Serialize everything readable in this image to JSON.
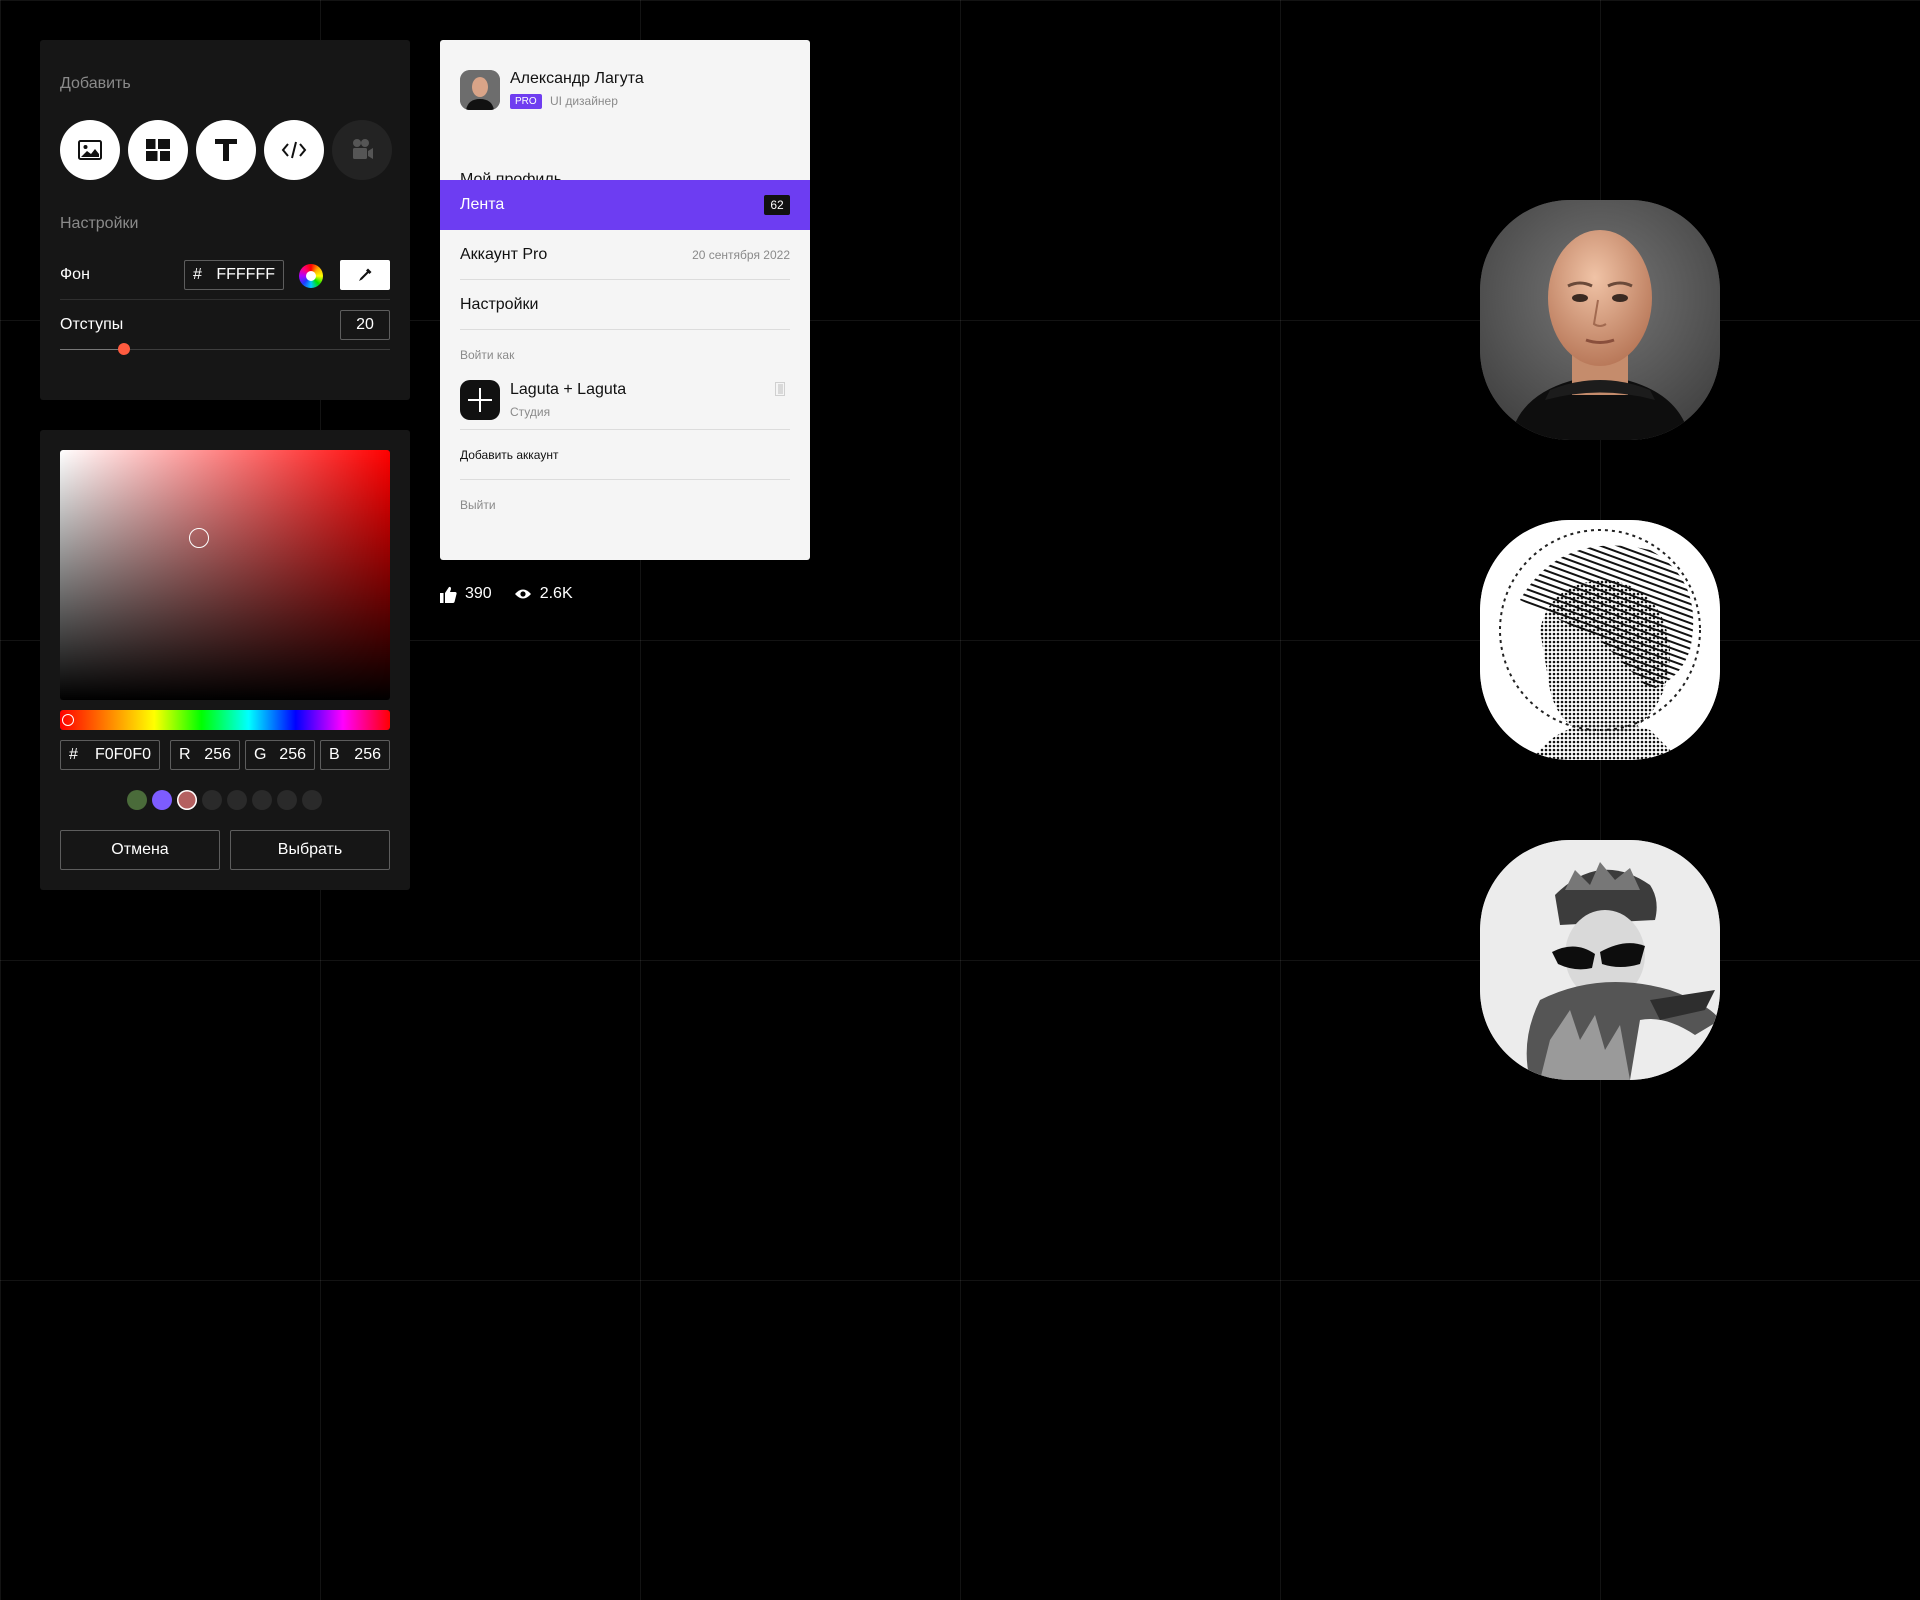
{
  "add_panel": {
    "title": "Добавить",
    "buttons": [
      {
        "icon": "image-icon"
      },
      {
        "icon": "layout-grid-icon"
      },
      {
        "icon": "text-icon"
      },
      {
        "icon": "code-icon"
      },
      {
        "icon": "video-camera-icon",
        "disabled": true
      }
    ],
    "settings_title": "Настройки",
    "background": {
      "label": "Фон",
      "hash": "#",
      "value": "FFFFFF"
    },
    "padding": {
      "label": "Отступы",
      "value": "20",
      "fraction": 0.195
    }
  },
  "color_picker": {
    "hue_fraction": 0.025,
    "saturation": 0.42,
    "brightness": 0.65,
    "hex": {
      "hash": "#",
      "value": "F0F0F0"
    },
    "r": {
      "label": "R",
      "value": "256"
    },
    "g": {
      "label": "G",
      "value": "256"
    },
    "b": {
      "label": "B",
      "value": "256"
    },
    "swatches": [
      "#4a6b3a",
      "#7d5cff",
      "#b46060",
      "#2a2a2a",
      "#2a2a2a",
      "#2a2a2a",
      "#2a2a2a",
      "#2a2a2a"
    ],
    "selected_swatch": 2,
    "cancel_label": "Отмена",
    "select_label": "Выбрать"
  },
  "account_menu": {
    "user": {
      "name": "Александр Лагута",
      "badge": "PRO",
      "role": "UI дизайнер"
    },
    "my_profile": "Мой профиль",
    "feed": {
      "label": "Лента",
      "count": "62"
    },
    "account_pro": {
      "label": "Аккаунт Pro",
      "date": "20 сентября 2022"
    },
    "settings": "Настройки",
    "login_as": "Войти как",
    "studio": {
      "name": "Laguta + Laguta",
      "type": "Студия"
    },
    "add_account": "Добавить аккаунт",
    "logout": "Выйти",
    "accent": "#6d3df2"
  },
  "stats": {
    "likes": "390",
    "views": "2.6K"
  }
}
